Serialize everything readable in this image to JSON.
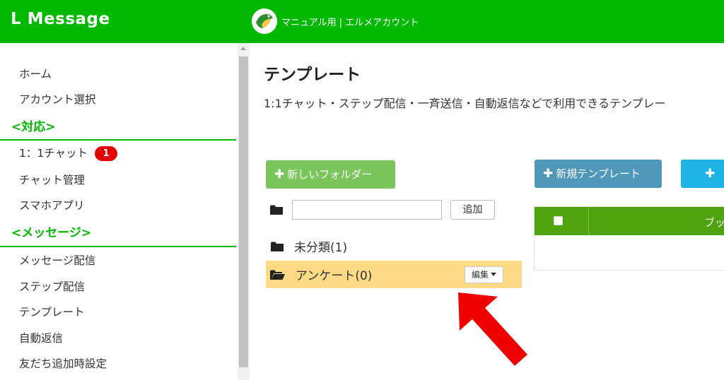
{
  "header": {
    "logo": "L Message",
    "account_name": "マニュアル用 | エルメアカウント"
  },
  "sidebar": {
    "items": [
      {
        "label": "ホーム"
      },
      {
        "label": "アカウント選択"
      },
      {
        "section": "<対応>"
      },
      {
        "label": "1：1チャット",
        "badge": "1"
      },
      {
        "label": "チャット管理"
      },
      {
        "label": "スマホアプリ"
      },
      {
        "section": "<メッセージ>"
      },
      {
        "label": "メッセージ配信"
      },
      {
        "label": "ステップ配信"
      },
      {
        "label": "テンプレート"
      },
      {
        "label": "自動返信"
      },
      {
        "label": "友だち追加時設定"
      }
    ]
  },
  "main": {
    "title": "テンプレート",
    "description": "1:1チャット・ステップ配信・一斉送信・自動返信などで利用できるテンプレー",
    "new_folder_label": "新しいフォルダー",
    "new_template_label": "新規テンプレート",
    "extra_button_label": "",
    "folder_input_value": "",
    "add_label": "追加",
    "folders": [
      {
        "name": "未分類(1)",
        "selected": false
      },
      {
        "name": "アンケート(0)",
        "selected": true
      }
    ],
    "edit_label": "編集",
    "table_header_label": "ブッ"
  },
  "colors": {
    "brand_green": "#00b900",
    "new_folder_button": "#7ac55c",
    "new_template_button": "#5098b9",
    "extra_button": "#1fb3e6",
    "table_header": "#4ea30f",
    "selected_folder": "#fddb86",
    "badge": "#e30000",
    "annotation_arrow": "#ee0000"
  },
  "icons": {
    "account_avatar": "bird-logo-icon",
    "folder_closed": "folder-icon",
    "folder_open": "folder-open-icon",
    "plus": "plus-icon",
    "annotation": "red-arrow-icon"
  }
}
